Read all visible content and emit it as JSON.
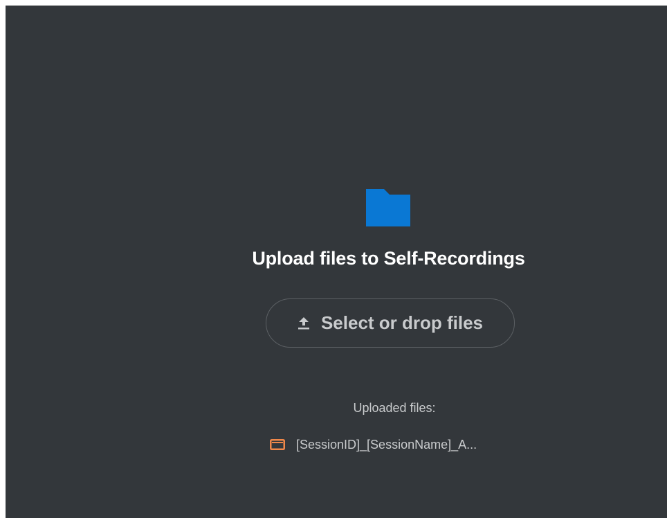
{
  "upload": {
    "title": "Upload files to Self-Recordings",
    "button_label": "Select or drop files",
    "uploaded_label": "Uploaded files:"
  },
  "files": [
    {
      "name": "[SessionID]_[SessionName]_A..."
    }
  ],
  "icons": {
    "folder": "folder-icon",
    "upload": "upload-icon",
    "file": "video-file-icon"
  },
  "colors": {
    "background": "#33373b",
    "folder": "#0a78d4",
    "file_icon": "#f0884a",
    "title_text": "#ffffff",
    "muted_text": "#c9cbcd",
    "button_border": "#5c6064"
  }
}
